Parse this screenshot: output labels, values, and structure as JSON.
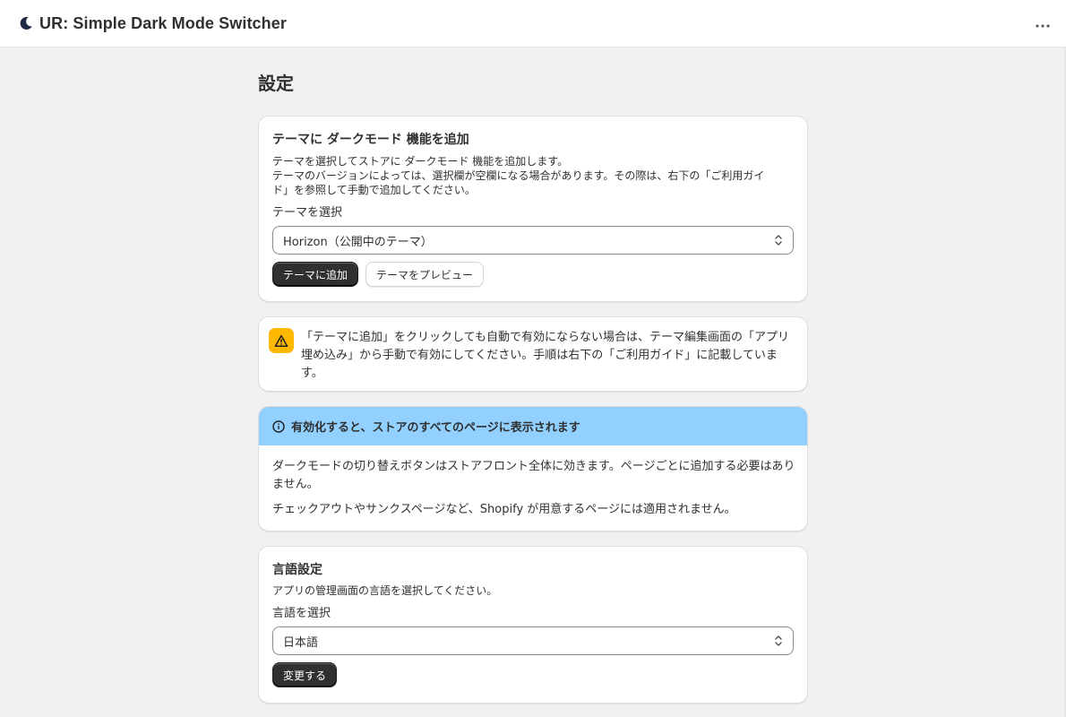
{
  "header": {
    "app_title": "UR: Simple Dark Mode Switcher",
    "app_icon": "moon-icon",
    "more_icon": "ellipsis-icon"
  },
  "page": {
    "title": "設定"
  },
  "theme_card": {
    "heading": "テーマに ダークモード 機能を追加",
    "description_line1": "テーマを選択してストアに ダークモード 機能を追加します。",
    "description_line2": "テーマのバージョンによっては、選択欄が空欄になる場合があります。その際は、右下の「ご利用ガイド」を参照して手動で追加してください。",
    "select_label": "テーマを選択",
    "select_value": "Horizon（公開中のテーマ）",
    "add_button": "テーマに追加",
    "preview_button": "テーマをプレビュー"
  },
  "warning_card": {
    "icon": "alert-triangle-icon",
    "text": "「テーマに追加」をクリックしても自動で有効にならない場合は、テーマ編集画面の「アプリ埋め込み」から手動で有効にしてください。手順は右下の「ご利用ガイド」に記載しています。"
  },
  "info_card": {
    "icon": "info-circle-icon",
    "heading": "有効化すると、ストアのすべてのページに表示されます",
    "paragraph1": "ダークモードの切り替えボタンはストアフロント全体に効きます。ページごとに追加する必要はありません。",
    "paragraph2": "チェックアウトやサンクスページなど、Shopify が用意するページには適用されません。"
  },
  "language_card": {
    "heading": "言語設定",
    "description": "アプリの管理画面の言語を選択してください。",
    "select_label": "言語を選択",
    "select_value": "日本語",
    "change_button": "変更する"
  },
  "colors": {
    "background": "#f1f1f1",
    "primary_button": "#303030",
    "warning": "#ffb800",
    "info_banner": "#91d0ff"
  }
}
